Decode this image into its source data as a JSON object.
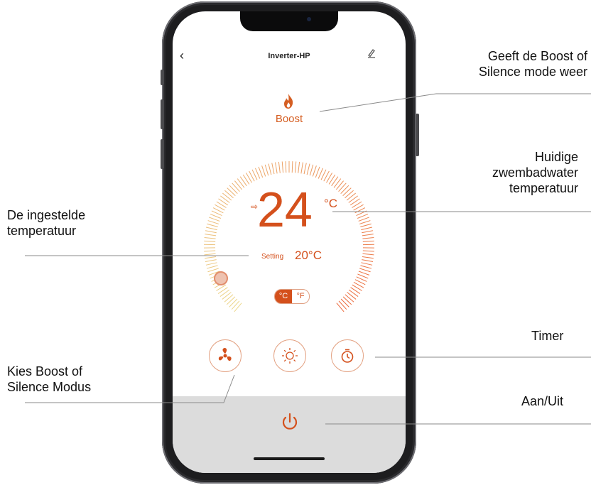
{
  "app": {
    "title": "Inverter-HP",
    "back_icon": "chevron-left-icon",
    "edit_icon": "pencil-icon"
  },
  "mode": {
    "label": "Boost",
    "icon": "flame-icon"
  },
  "temperature": {
    "current": "24",
    "unit": "°C",
    "setting_label": "Setting",
    "setting_value": "20°C"
  },
  "unit_toggle": {
    "celsius": "°C",
    "fahrenheit": "°F"
  },
  "controls": [
    {
      "name": "fan-mode-button",
      "icon": "fan-icon"
    },
    {
      "name": "sun-mode-button",
      "icon": "sun-icon"
    },
    {
      "name": "timer-button",
      "icon": "timer-icon"
    }
  ],
  "power": {
    "icon": "power-icon"
  },
  "annotations": {
    "mode": [
      "Geeft de Boost of",
      "Silence mode weer"
    ],
    "current_temp": [
      "Huidige",
      "zwembadwater",
      "temperatuur"
    ],
    "set_temp": [
      "De ingestelde",
      "temperatuur"
    ],
    "timer": [
      "Timer"
    ],
    "mode_select": [
      "Kies Boost of",
      "Silence Modus"
    ],
    "power": [
      "Aan/Uit"
    ]
  },
  "colors": {
    "accent": "#d4501c",
    "accent_light": "#e3a283",
    "bottom_bar": "#dcdcdc",
    "phone_frame": "#1d1d1f"
  }
}
